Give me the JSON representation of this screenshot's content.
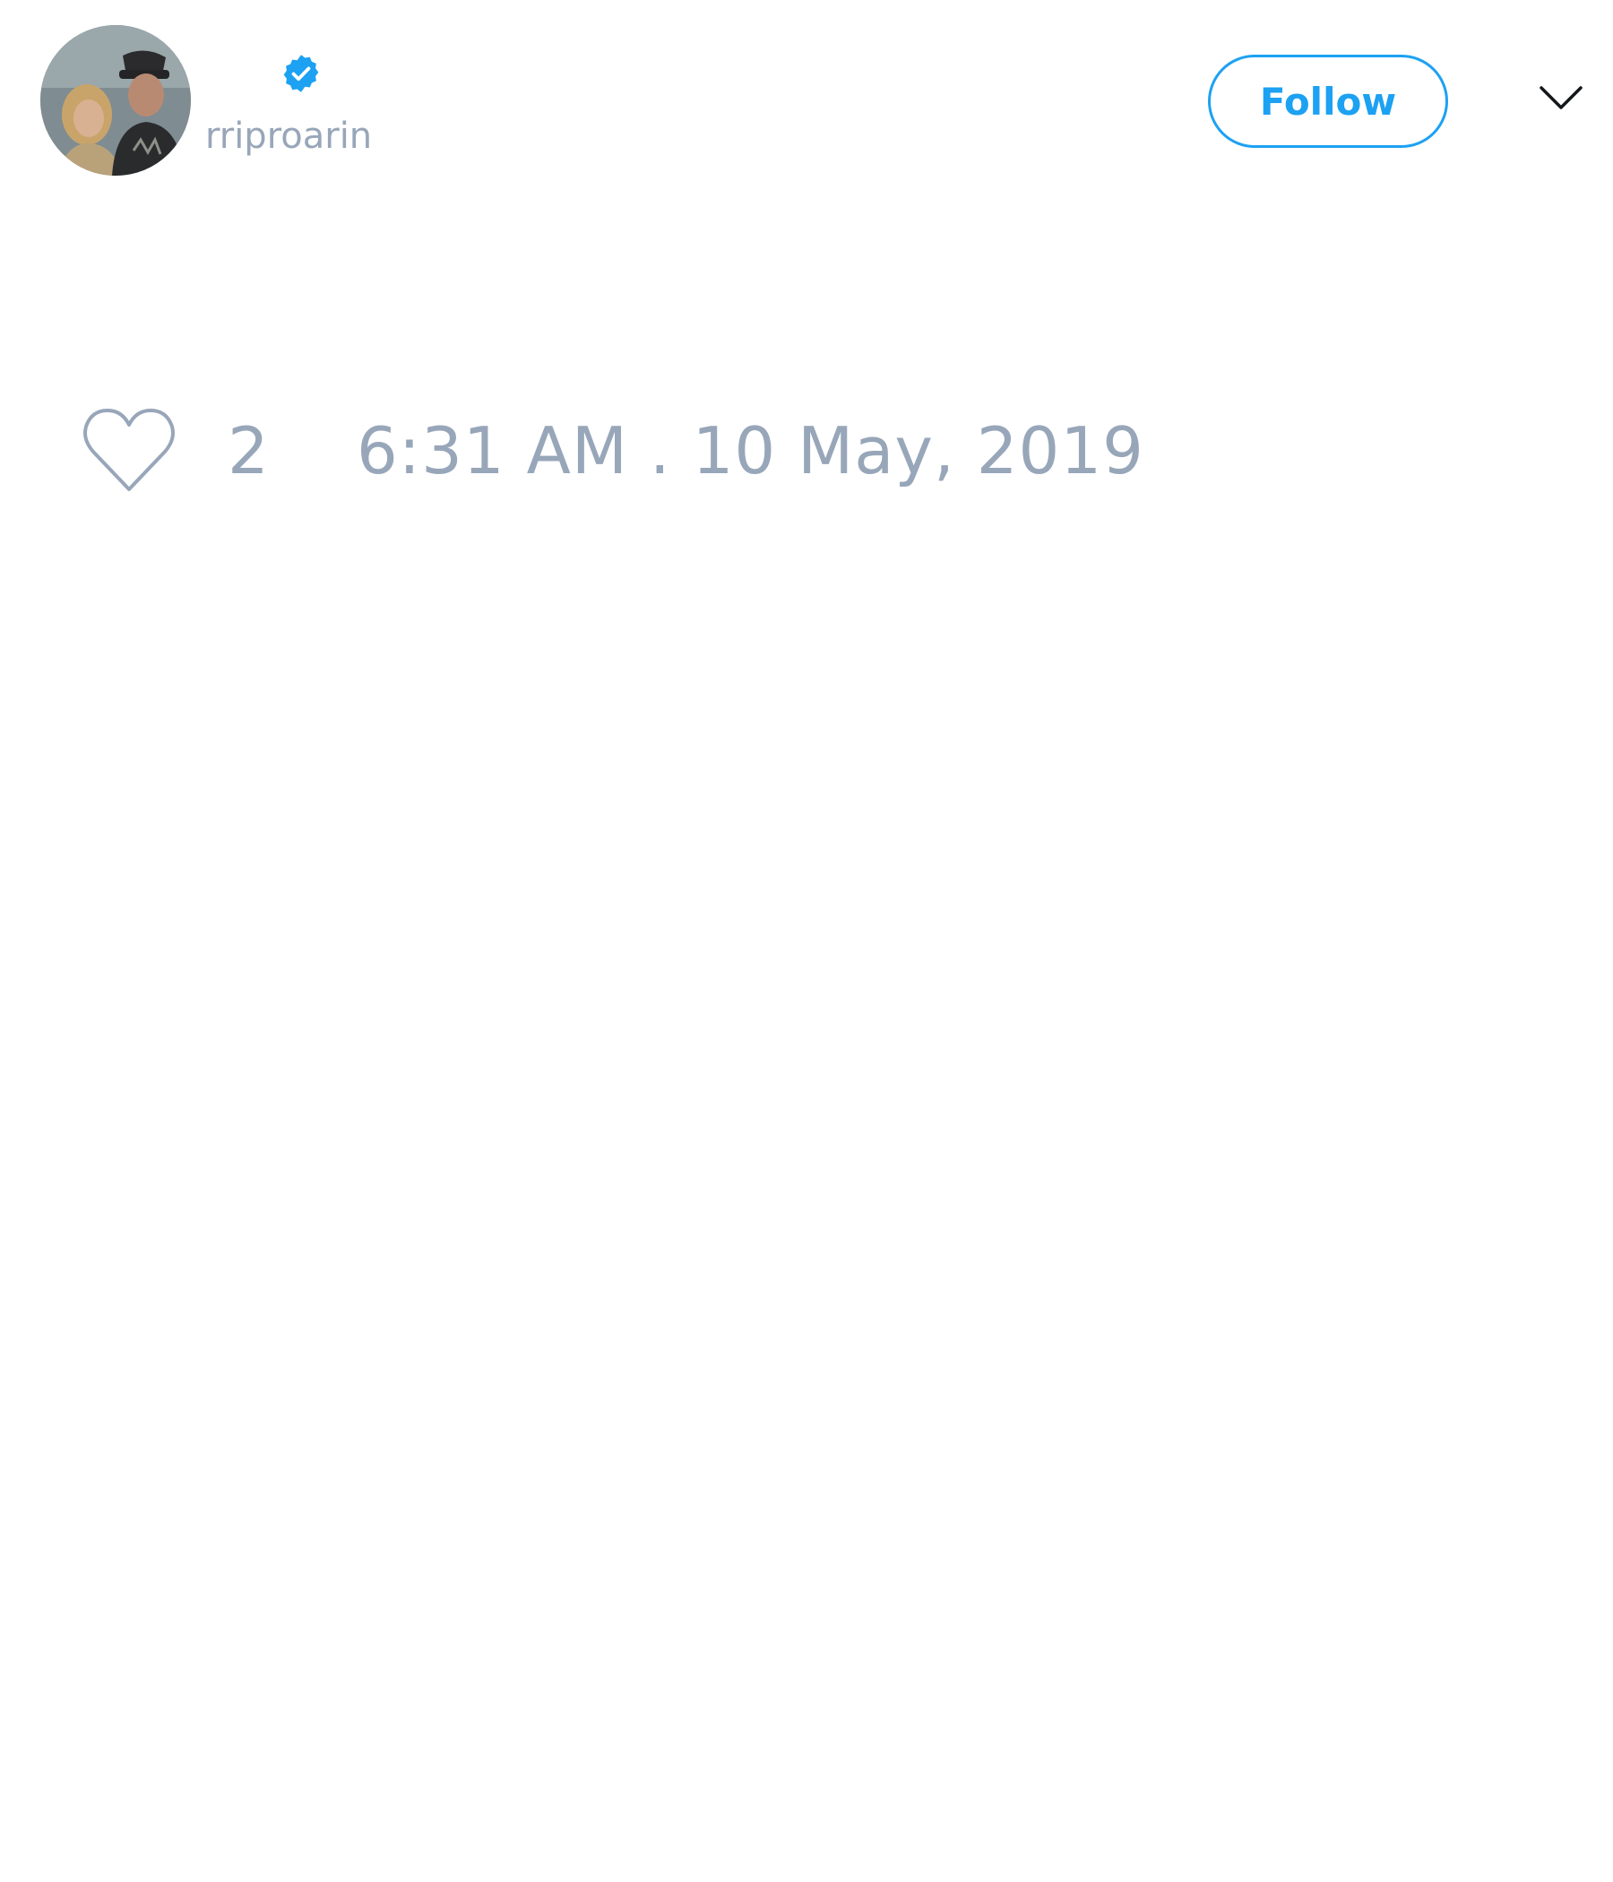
{
  "user": {
    "handle": "rriproarin",
    "verified": true,
    "avatar_icon": "user-photo"
  },
  "actions": {
    "follow_label": "Follow",
    "more_icon": "chevron-down-icon"
  },
  "stats": {
    "like_icon": "heart-outline-icon",
    "like_count": "2",
    "timestamp": "6:31 AM . 10 May, 2019"
  },
  "colors": {
    "accent": "#1da1f2",
    "muted_text": "#98a6b9",
    "background": "#ffffff"
  }
}
